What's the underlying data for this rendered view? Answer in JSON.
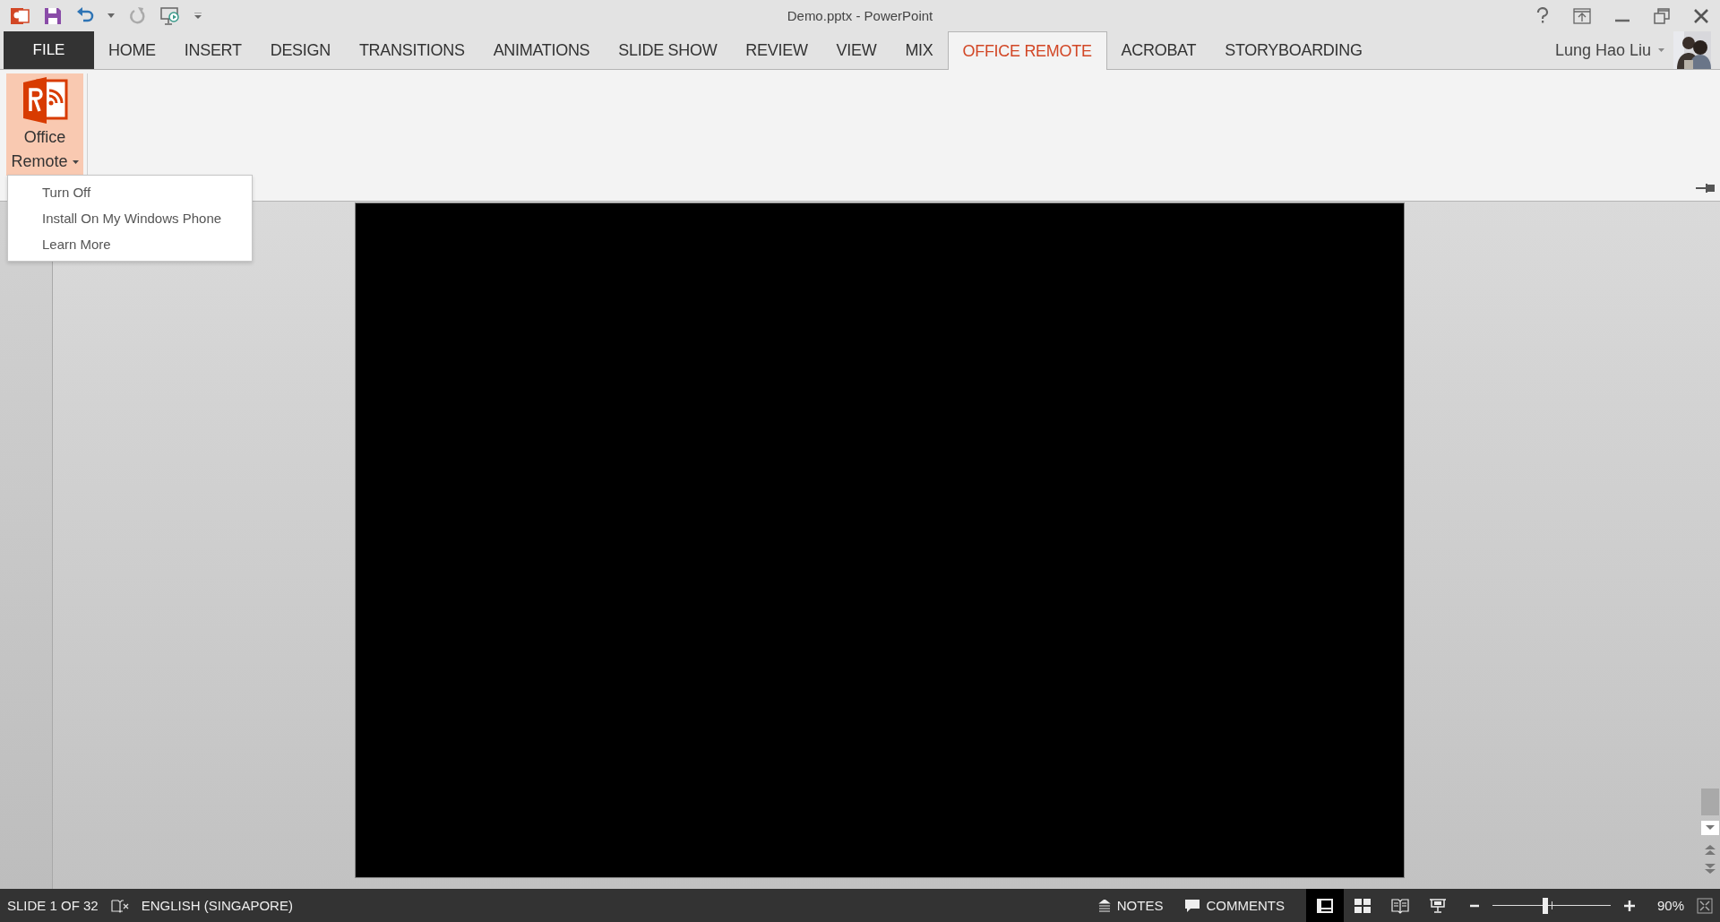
{
  "window": {
    "title": "Demo.pptx - PowerPoint"
  },
  "tabs": [
    {
      "label": "FILE",
      "kind": "file",
      "selected": false
    },
    {
      "label": "HOME",
      "kind": "tab",
      "selected": false
    },
    {
      "label": "INSERT",
      "kind": "tab",
      "selected": false
    },
    {
      "label": "DESIGN",
      "kind": "tab",
      "selected": false
    },
    {
      "label": "TRANSITIONS",
      "kind": "tab",
      "selected": false
    },
    {
      "label": "ANIMATIONS",
      "kind": "tab",
      "selected": false
    },
    {
      "label": "SLIDE SHOW",
      "kind": "tab",
      "selected": false
    },
    {
      "label": "REVIEW",
      "kind": "tab",
      "selected": false
    },
    {
      "label": "VIEW",
      "kind": "tab",
      "selected": false
    },
    {
      "label": "MIX",
      "kind": "tab",
      "selected": false
    },
    {
      "label": "OFFICE REMOTE",
      "kind": "tab",
      "selected": true
    },
    {
      "label": "ACROBAT",
      "kind": "tab",
      "selected": false
    },
    {
      "label": "STORYBOARDING",
      "kind": "tab",
      "selected": false
    }
  ],
  "account": {
    "name": "Lung Hao Liu"
  },
  "ribbon": {
    "button": {
      "label_line_1": "Office",
      "label_line_2": "Remote",
      "expanded": true
    },
    "menu": [
      {
        "label": "Turn Off"
      },
      {
        "label": "Install On My Windows Phone"
      },
      {
        "label": "Learn More"
      }
    ]
  },
  "status_bar": {
    "slide": "SLIDE 1 OF 32",
    "language": "ENGLISH (SINGAPORE)",
    "notes": "NOTES",
    "comments": "COMMENTS",
    "views": [
      {
        "kind": "normal",
        "selected": true
      },
      {
        "kind": "sorter",
        "selected": false
      },
      {
        "kind": "reading",
        "selected": false
      },
      {
        "kind": "show",
        "selected": false
      }
    ],
    "zoom": {
      "level": 0.45,
      "reading": "90%"
    }
  }
}
